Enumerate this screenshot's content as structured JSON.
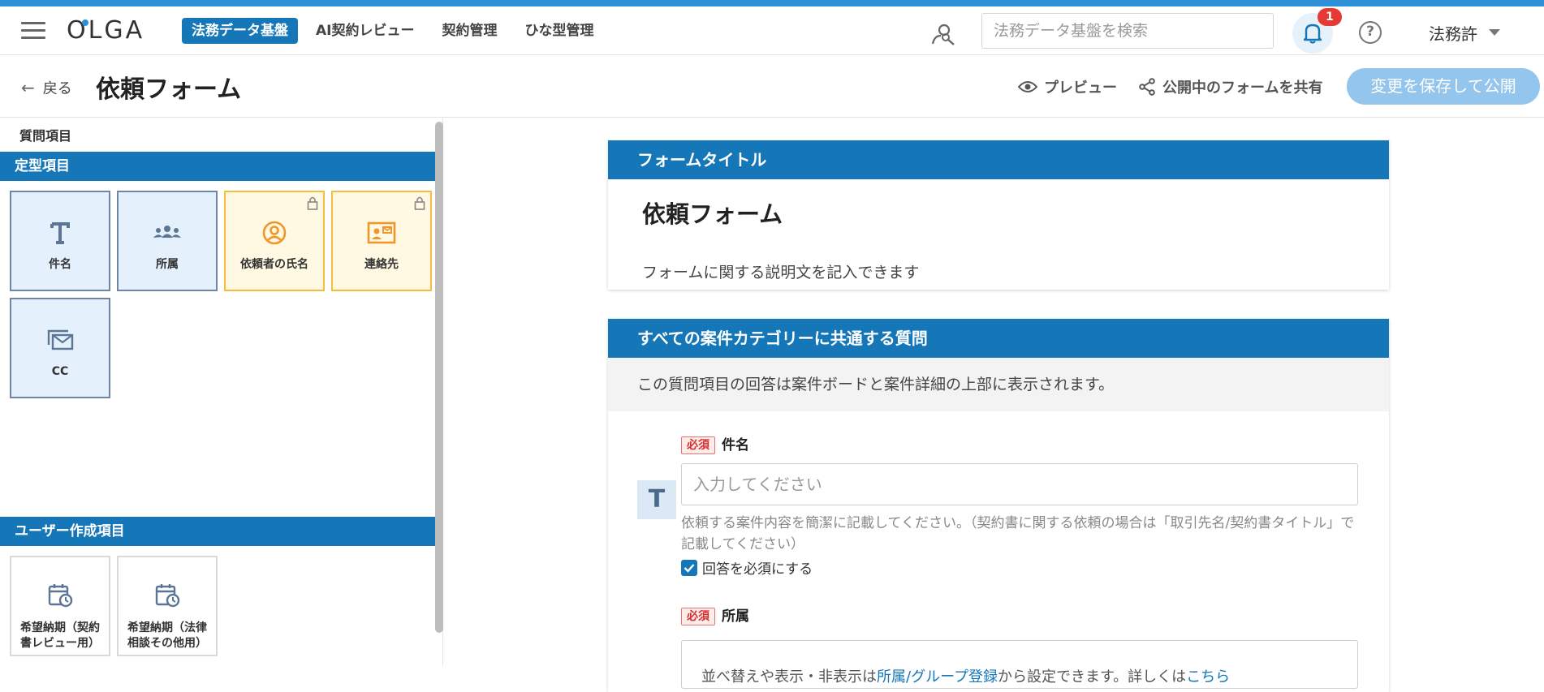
{
  "header": {
    "logo": "OLGA",
    "nav": [
      {
        "label": "法務データ基盤",
        "active": true
      },
      {
        "label": "AI契約レビュー",
        "active": false
      },
      {
        "label": "契約管理",
        "active": false
      },
      {
        "label": "ひな型管理",
        "active": false
      }
    ],
    "search_placeholder": "法務データ基盤を検索",
    "notification_count": "1",
    "help_label": "?",
    "user_name": "法務許"
  },
  "subheader": {
    "back_label": "戻る",
    "title": "依頼フォーム",
    "preview_label": "プレビュー",
    "share_label": "公開中のフォームを共有",
    "publish_label": "変更を保存して公開"
  },
  "left": {
    "section_label": "質問項目",
    "fixed_category": "定型項目",
    "fixed_tiles": [
      {
        "label": "件名",
        "icon": "text-icon",
        "locked": false
      },
      {
        "label": "所属",
        "icon": "group-icon",
        "locked": false
      },
      {
        "label": "依頼者の氏名",
        "icon": "person-icon",
        "locked": true
      },
      {
        "label": "連絡先",
        "icon": "contact-card-icon",
        "locked": true
      },
      {
        "label": "CC",
        "icon": "mail-stack-icon",
        "locked": false
      }
    ],
    "user_category": "ユーザー作成項目",
    "user_tiles": [
      {
        "label": "希望納期（契約書レビュー用）",
        "icon": "calendar-clock-icon"
      },
      {
        "label": "希望納期（法律相談その他用）",
        "icon": "calendar-clock-icon"
      }
    ]
  },
  "main": {
    "title_card": {
      "header": "フォームタイトル",
      "title": "依頼フォーム",
      "description": "フォームに関する説明文を記入できます"
    },
    "common_card": {
      "header": "すべての案件カテゴリーに共通する質問",
      "note": "この質問項目の回答は案件ボードと案件詳細の上部に表示されます。",
      "questions": [
        {
          "required_label": "必須",
          "label": "件名",
          "icon_letter": "T",
          "placeholder": "入力してください",
          "help": "依頼する案件内容を簡潔に記載してください。（契約書に関する依頼の場合は「取引先名/契約書タイトル」で記載してください）",
          "check_label": "回答を必須にする"
        },
        {
          "required_label": "必須",
          "label": "所属",
          "text_before": "並べ替えや表示・非表示は",
          "link1": "所属/グループ登録",
          "text_mid": "から設定できます。詳しくは",
          "link2": "こちら"
        }
      ]
    }
  },
  "colors": {
    "primary": "#1577b8",
    "topstrip": "#2e8fd6",
    "publish_disabled": "#94c5ec",
    "tile_blue_bg": "#e4f1fc",
    "tile_locked_border": "#f5bd3d",
    "required_red": "#d32f2f"
  }
}
